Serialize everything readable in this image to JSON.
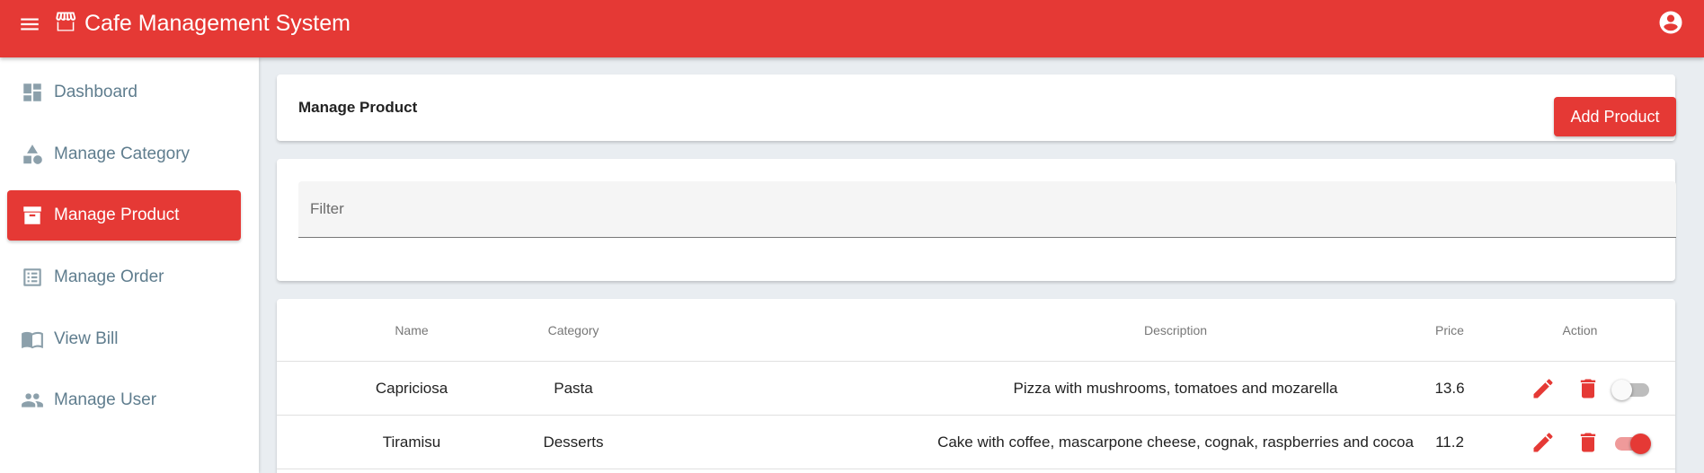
{
  "app": {
    "title": "Cafe Management System"
  },
  "sidebar": {
    "items": [
      {
        "label": "Dashboard",
        "icon": "dashboard-icon",
        "active": false
      },
      {
        "label": "Manage Category",
        "icon": "category-icon",
        "active": false
      },
      {
        "label": "Manage Product",
        "icon": "inventory-icon",
        "active": true
      },
      {
        "label": "Manage Order",
        "icon": "list-alt-icon",
        "active": false
      },
      {
        "label": "View Bill",
        "icon": "book-icon",
        "active": false
      },
      {
        "label": "Manage User",
        "icon": "people-icon",
        "active": false
      }
    ]
  },
  "header": {
    "title": "Manage Product",
    "add_label": "Add Product"
  },
  "filter": {
    "placeholder": "Filter",
    "value": ""
  },
  "table": {
    "columns": [
      "Name",
      "Category",
      "Description",
      "Price",
      "Action"
    ],
    "rows": [
      {
        "name": "Capriciosa",
        "category": "Pasta",
        "description": "Pizza with mushrooms, tomatoes and mozarella",
        "price": "13.6",
        "status": false
      },
      {
        "name": "Tiramisu",
        "category": "Desserts",
        "description": "Cake with coffee, mascarpone cheese, cognak, raspberries and cocoa",
        "price": "11.2",
        "status": true
      }
    ]
  },
  "colors": {
    "primary": "#e53935",
    "sidebar_text": "#5f7d8e",
    "background": "#e9edf1"
  }
}
